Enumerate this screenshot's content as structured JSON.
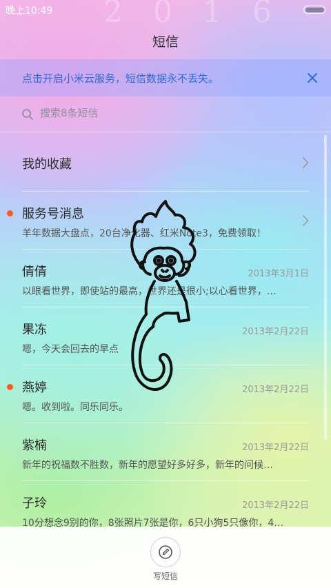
{
  "status_bar": {
    "time": "晚上10:49",
    "year_watermark": "2016"
  },
  "header": {
    "title": "短信"
  },
  "banner": {
    "text": "点击开启小米云服务，短信数据永不丢失。",
    "accent_color": "#2f6bd6",
    "close_icon": "close-icon"
  },
  "search": {
    "placeholder": "搜索8条短信",
    "icon": "search-icon"
  },
  "favorites": {
    "label": "我的收藏"
  },
  "conversations": [
    {
      "name": "服务号消息",
      "preview": "羊年数据大盘点，20台净化器、红米Note3，免费领取！",
      "date": "",
      "unread": true
    },
    {
      "name": "倩倩",
      "preview": "以眼看世界，即使站的最高，世界还是很小;以心看世界，…",
      "date": "2013年3月1日",
      "unread": false
    },
    {
      "name": "果冻",
      "preview": "嗯，今天会回去的早点",
      "date": "2013年2月22日",
      "unread": false
    },
    {
      "name": "燕婷",
      "preview": "嗯。收到啦。同乐同乐。",
      "date": "2013年2月22日",
      "unread": true
    },
    {
      "name": "紫楠",
      "preview": "新年的祝福数不胜数，新年的愿望好多好多，新年的问候…",
      "date": "2013年2月22日",
      "unread": false
    },
    {
      "name": "子玲",
      "preview": "10分想念9别的你，8张照片7张是你，6只小狗5只像你，4…",
      "date": "2013年2月22日",
      "unread": false
    }
  ],
  "bottom_bar": {
    "compose_label": "写短信",
    "compose_icon": "compose-icon"
  },
  "colors": {
    "unread_dot": "#ff5a1f",
    "banner_text": "#2f6bd6"
  }
}
